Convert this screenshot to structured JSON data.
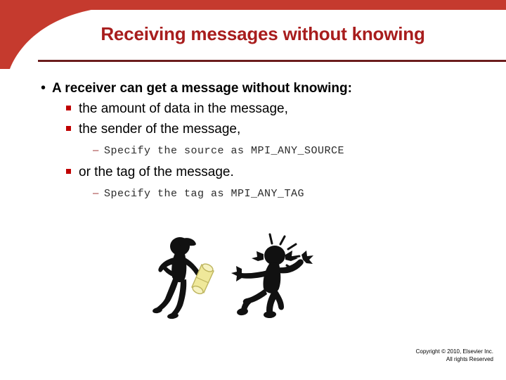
{
  "slide": {
    "title": "Receiving messages without knowing",
    "theme": {
      "banner_red": "#c53a2e",
      "title_red": "#a81d1d",
      "rule_red": "#6b1d1d",
      "sub_bullet_red": "#c00000",
      "dash_red": "#a03a3a",
      "scroll_yellow": "#efe89a",
      "figure_black": "#111111",
      "background": "#ffffff"
    }
  },
  "content": {
    "bullets": [
      {
        "level": 1,
        "marker": "•",
        "text": "A receiver can get a message without knowing:"
      },
      {
        "level": 2,
        "marker": "square",
        "text": "the amount of data in the message,"
      },
      {
        "level": 2,
        "marker": "square",
        "text": "the sender of the message,"
      },
      {
        "level": 3,
        "marker": "–",
        "text": "Specify the source as MPI_ANY_SOURCE"
      },
      {
        "level": 2,
        "marker": "square",
        "text": "or the tag of the message."
      },
      {
        "level": 3,
        "marker": "–",
        "text": "Specify the tag as MPI_ANY_TAG"
      }
    ]
  },
  "illustration": {
    "alt": "two stick figures, a messenger handing over a yellow scroll and a surprised running figure",
    "left_figure_name": "messenger-figure",
    "right_figure_name": "surprised-runner-figure"
  },
  "footer": {
    "copyright_line1": "Copyright © 2010, Elsevier Inc.",
    "copyright_line2": "All rights Reserved"
  }
}
